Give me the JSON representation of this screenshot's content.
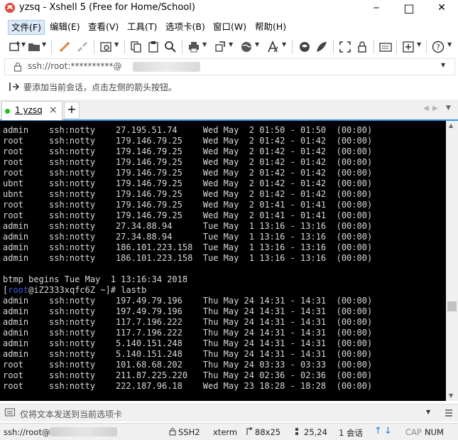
{
  "window": {
    "title": "yzsq - Xshell 5 (Free for Home/School)",
    "minimize_glyph": "─",
    "maximize_glyph": "□",
    "close_glyph": "✕"
  },
  "menu": {
    "items": [
      "文件(F)",
      "编辑(E)",
      "查看(V)",
      "工具(T)",
      "选项卡(B)",
      "窗口(W)",
      "帮助(H)"
    ]
  },
  "address": {
    "text": "ssh://root:**********@"
  },
  "hint": {
    "text": "要添加当前会话，点击左侧的箭头按钮。"
  },
  "tabs": {
    "active_label": "1 yzsq",
    "close_glyph": "×",
    "new_glyph": "+"
  },
  "terminal": {
    "lines": [
      "admin    ssh:notty    27.195.51.74     Wed May  2 01:50 - 01:50  (00:00)",
      "root     ssh:notty    179.146.79.25    Wed May  2 01:42 - 01:42  (00:00)",
      "root     ssh:notty    179.146.79.25    Wed May  2 01:42 - 01:42  (00:00)",
      "root     ssh:notty    179.146.79.25    Wed May  2 01:42 - 01:42  (00:00)",
      "root     ssh:notty    179.146.79.25    Wed May  2 01:42 - 01:42  (00:00)",
      "ubnt     ssh:notty    179.146.79.25    Wed May  2 01:42 - 01:42  (00:00)",
      "ubnt     ssh:notty    179.146.79.25    Wed May  2 01:42 - 01:42  (00:00)",
      "root     ssh:notty    179.146.79.25    Wed May  2 01:41 - 01:41  (00:00)",
      "root     ssh:notty    179.146.79.25    Wed May  2 01:41 - 01:41  (00:00)",
      "admin    ssh:notty    27.34.88.94      Tue May  1 13:16 - 13:16  (00:00)",
      "admin    ssh:notty    27.34.88.94      Tue May  1 13:16 - 13:16  (00:00)",
      "admin    ssh:notty    186.101.223.158  Tue May  1 13:16 - 13:16  (00:00)",
      "admin    ssh:notty    186.101.223.158  Tue May  1 13:16 - 13:16  (00:00)",
      "",
      "btmp begins Tue May  1 13:16:34 2018",
      "",
      "admin    ssh:notty    197.49.79.196    Thu May 24 14:31 - 14:31  (00:00)",
      "admin    ssh:notty    197.49.79.196    Thu May 24 14:31 - 14:31  (00:00)",
      "admin    ssh:notty    117.7.196.222    Thu May 24 14:31 - 14:31  (00:00)",
      "admin    ssh:notty    117.7.196.222    Thu May 24 14:31 - 14:31  (00:00)",
      "admin    ssh:notty    5.140.151.248    Thu May 24 14:31 - 14:31  (00:00)",
      "admin    ssh:notty    5.140.151.248    Thu May 24 14:31 - 14:31  (00:00)",
      "root     ssh:notty    101.68.68.202    Thu May 24 03:33 - 03:33  (00:00)",
      "root     ssh:notty    211.87.225.220   Thu May 24 02:36 - 02:36  (00:00)",
      "root     ssh:notty    222.187.96.18    Wed May 23 18:28 - 18:28  (00:00)"
    ],
    "prompt_open": "[",
    "prompt_user": "root",
    "prompt_host": "@iZ2333xqfc6Z ~",
    "prompt_tail": "]# lastb",
    "colors": {
      "background": "#000000",
      "text": "#d8d8d8",
      "prompt_user": "#3a5bd8"
    }
  },
  "send_bar": {
    "placeholder": "仅将文本发送到当前选项卡"
  },
  "status": {
    "host": "ssh://root@",
    "protocol": "SSH2",
    "terminal_type": "xterm",
    "size": "88x25",
    "cursor": "25,24",
    "sessions": "1 会话",
    "caps": "CAP",
    "num": "NUM"
  },
  "accent": "#2f95ea"
}
